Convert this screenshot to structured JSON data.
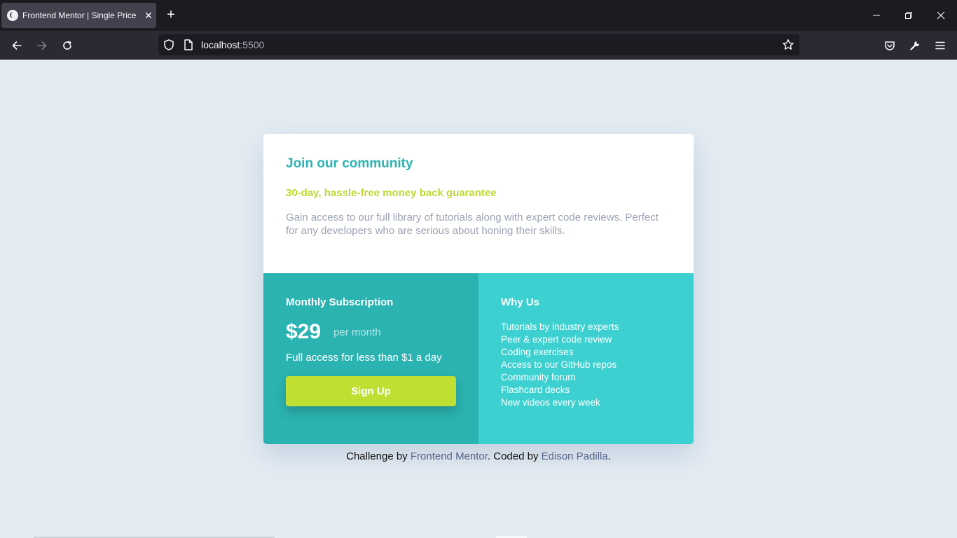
{
  "browser": {
    "tab_title": "Frontend Mentor | Single Price Grid Component",
    "tab_close": "✕",
    "new_tab": "+",
    "url_host": "localhost",
    "url_port": ":5500"
  },
  "card": {
    "title": "Join our community",
    "subtitle": "30-day, hassle-free money back guarantee",
    "description": "Gain access to our full library of tutorials along with expert code reviews. Perfect for any developers who are serious about honing their skills."
  },
  "subscription": {
    "heading": "Monthly Subscription",
    "price": "$29",
    "period": "per month",
    "note": "Full access for less than $1 a day",
    "button": "Sign Up"
  },
  "why_us": {
    "heading": "Why Us",
    "items": [
      "Tutorials by industry experts",
      "Peer & expert code review",
      "Coding exercises",
      "Access to our GitHub repos",
      "Community forum",
      "Flashcard decks",
      "New videos every week"
    ]
  },
  "attribution": {
    "prefix": "Challenge by ",
    "link1": "Frontend Mentor",
    "middle": ". Coded by ",
    "link2": "Edison Padilla",
    "suffix": "."
  },
  "colors": {
    "teal": "#2bb3b1",
    "light_teal": "#3cd0d0",
    "lime": "#bfdf32",
    "page_bg": "#e4ecf3"
  }
}
